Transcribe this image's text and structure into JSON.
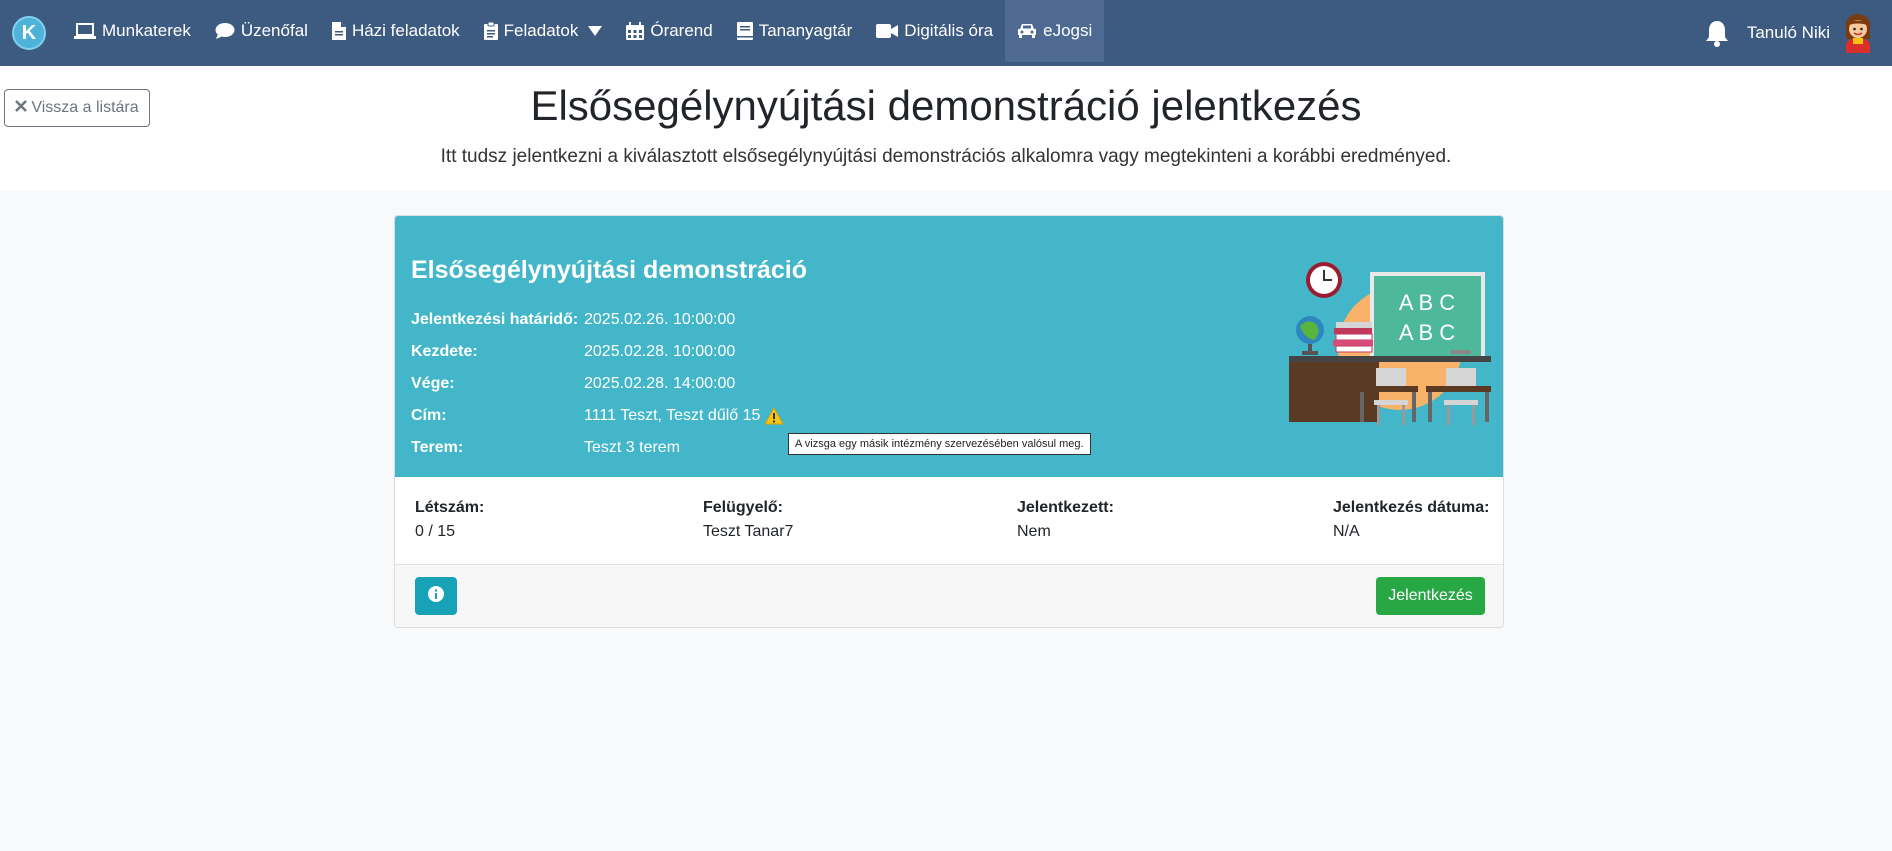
{
  "nav": {
    "logo": "K",
    "items": [
      {
        "label": "Munkaterek",
        "icon": "laptop-icon"
      },
      {
        "label": "Üzenőfal",
        "icon": "comment-icon"
      },
      {
        "label": "Házi feladatok",
        "icon": "file-icon"
      },
      {
        "label": "Feladatok",
        "icon": "clipboard-icon"
      },
      {
        "label": "Órarend",
        "icon": "calendar-icon"
      },
      {
        "label": "Tananyagtár",
        "icon": "book-icon"
      },
      {
        "label": "Digitális óra",
        "icon": "video-icon"
      },
      {
        "label": "eJogsi",
        "icon": "car-icon"
      }
    ],
    "active": "eJogsi",
    "user_name": "Tanuló Niki"
  },
  "header": {
    "back_label": "Vissza a listára",
    "title": "Elsősegélynyújtási demonstráció jelentkezés",
    "subtitle": "Itt tudsz jelentkezni a kiválasztott elsősegélynyújtási demonstrációs alkalomra vagy megtekinteni a korábbi eredményed."
  },
  "card": {
    "title": "Elsősegélynyújtási demonstráció",
    "details": [
      {
        "label": "Jelentkezési határidő:",
        "value": "2025.02.26. 10:00:00"
      },
      {
        "label": "Kezdete:",
        "value": "2025.02.28. 10:00:00"
      },
      {
        "label": "Vége:",
        "value": "2025.02.28. 14:00:00"
      },
      {
        "label": "Cím:",
        "value": "1111 Teszt, Teszt dűlő 15"
      },
      {
        "label": "Terem:",
        "value": "Teszt 3 terem"
      }
    ],
    "tooltip": "A vizsga egy másik intézmény szervezésében valósul meg.",
    "illustration_text": [
      "A B C",
      "A B C"
    ],
    "stats": [
      {
        "label": "Létszám:",
        "value": "0 / 15"
      },
      {
        "label": "Felügyelő:",
        "value": "Teszt Tanar7"
      },
      {
        "label": "Jelentkezett:",
        "value": "Nem"
      },
      {
        "label": "Jelentkezés dátuma:",
        "value": "N/A"
      }
    ],
    "join_label": "Jelentkezés"
  },
  "colors": {
    "navbar": "#3d5a80",
    "card_header": "#43b7c9",
    "join_button": "#28a745",
    "info_button": "#17a2b8"
  }
}
